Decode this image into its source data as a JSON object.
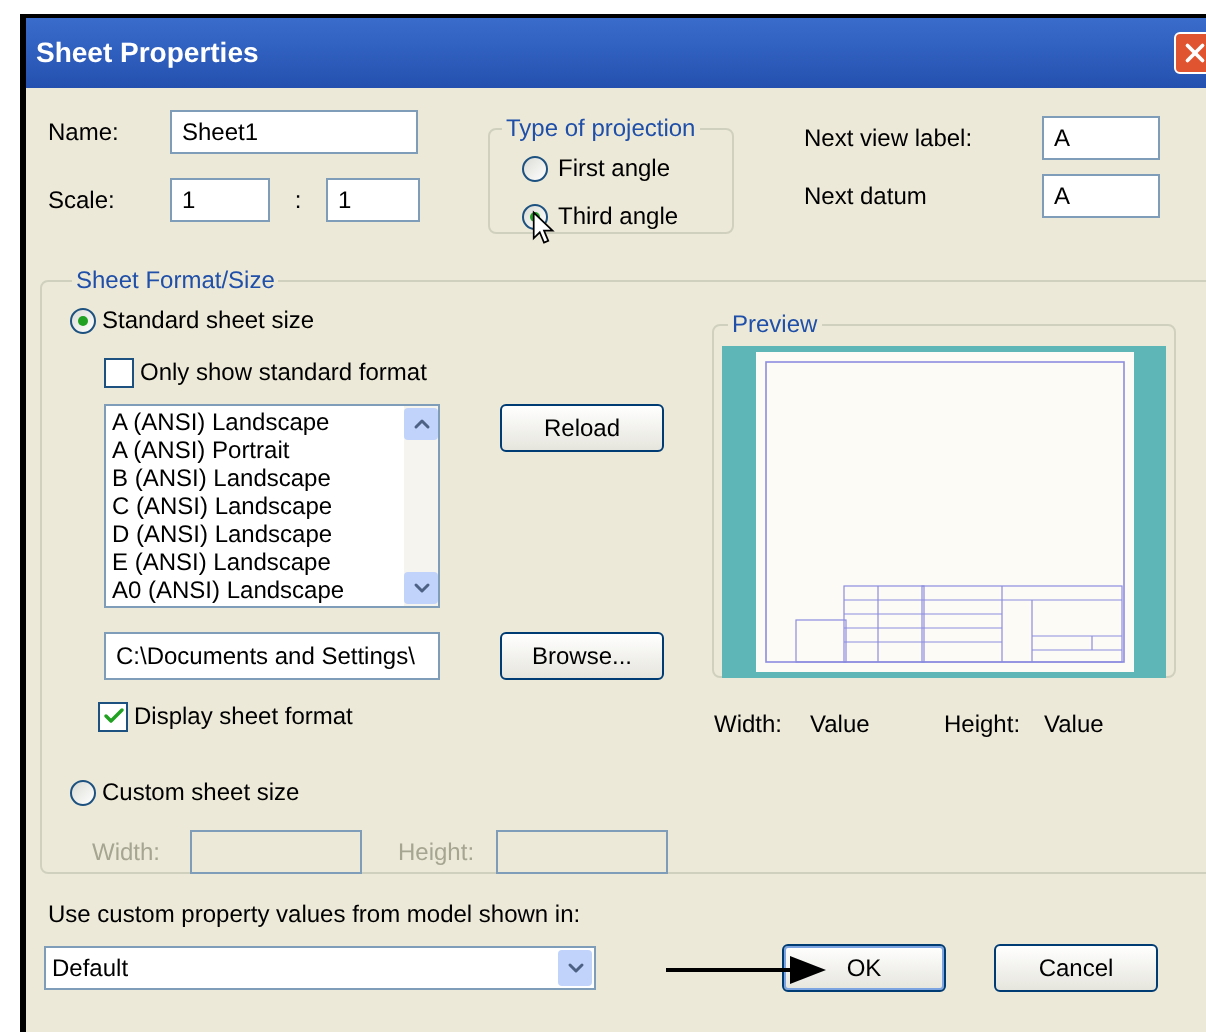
{
  "window": {
    "title": "Sheet Properties"
  },
  "name": {
    "label": "Name:",
    "value": "Sheet1"
  },
  "scale": {
    "label": "Scale:",
    "numerator": "1",
    "separator": ":",
    "denominator": "1"
  },
  "projection": {
    "title": "Type of projection",
    "options": [
      {
        "label": "First angle",
        "selected": false
      },
      {
        "label": "Third angle",
        "selected": true
      }
    ]
  },
  "next_view_label": {
    "label": "Next view label:",
    "value": "A"
  },
  "next_datum": {
    "label": "Next datum",
    "value": "A"
  },
  "sheet_format": {
    "title": "Sheet Format/Size",
    "standard": {
      "label": "Standard sheet size",
      "selected": true
    },
    "only_standard": {
      "label": "Only show standard format",
      "checked": false
    },
    "formats": [
      {
        "label": "A (ANSI) Landscape",
        "selected": false
      },
      {
        "label": "A (ANSI) Portrait",
        "selected": false
      },
      {
        "label": "B (ANSI) Landscape",
        "selected": false
      },
      {
        "label": "C (ANSI) Landscape",
        "selected": false
      },
      {
        "label": "D (ANSI) Landscape",
        "selected": false
      },
      {
        "label": "E (ANSI) Landscape",
        "selected": false
      },
      {
        "label": "A0 (ANSI) Landscape",
        "selected": false
      }
    ],
    "reload": "Reload",
    "path": "C:\\Documents and Settings\\",
    "browse": "Browse...",
    "display_format": {
      "label": "Display sheet format",
      "checked": true
    },
    "custom": {
      "label": "Custom sheet size",
      "selected": false
    },
    "custom_width": {
      "label": "Width:",
      "disabled": true
    },
    "custom_height": {
      "label": "Height:",
      "disabled": true
    },
    "preview": {
      "title": "Preview",
      "width_label": "Width:",
      "width_value": "Value",
      "height_label": "Height:",
      "height_value": "Value"
    }
  },
  "model_prompt": "Use custom property values from model shown in:",
  "configuration": {
    "value": "Default"
  },
  "buttons": [
    {
      "label": "OK",
      "kind": "default"
    },
    {
      "label": "Cancel",
      "kind": "normal"
    }
  ]
}
